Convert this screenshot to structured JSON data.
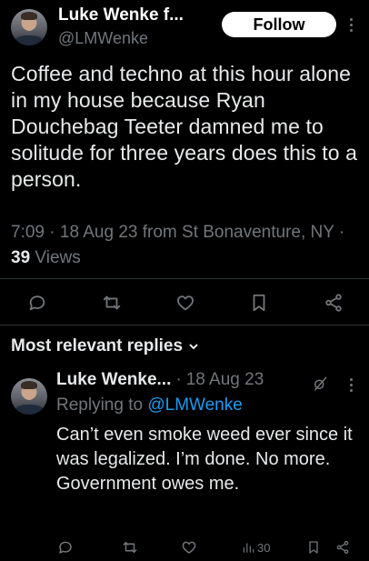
{
  "tweet": {
    "author_name": "Luke Wenke f...",
    "author_handle": "@LMWenke",
    "follow_label": "Follow",
    "text": "Coffee and techno at this hour alone in my house because Ryan Douchebag Teeter damned me to solitude for three years does this to a person.",
    "time": "7:09",
    "date": "18 Aug 23 from St Bonaventure, NY",
    "views_count": "39",
    "views_label": "Views"
  },
  "replies_section": {
    "heading": "Most relevant replies"
  },
  "reply": {
    "author_name": "Luke Wenke...",
    "date": "18 Aug 23",
    "replying_prefix": "Replying to",
    "replying_handle": "@LMWenke",
    "text": "Can’t even smoke weed ever since it was legalized.  I’m done.  No more.  Government owes me.",
    "views_count": "30"
  },
  "icons": {
    "reply": "reply-icon",
    "retweet": "retweet-icon",
    "like": "heart-icon",
    "bookmark": "bookmark-icon",
    "share": "share-icon",
    "views": "views-bar-icon",
    "grok": "grok-icon",
    "more": "more-vertical-icon"
  },
  "colors": {
    "background": "#000000",
    "text": "#e7e9ea",
    "muted": "#71767b",
    "link": "#1d9bf0",
    "divider": "#2f3336"
  }
}
